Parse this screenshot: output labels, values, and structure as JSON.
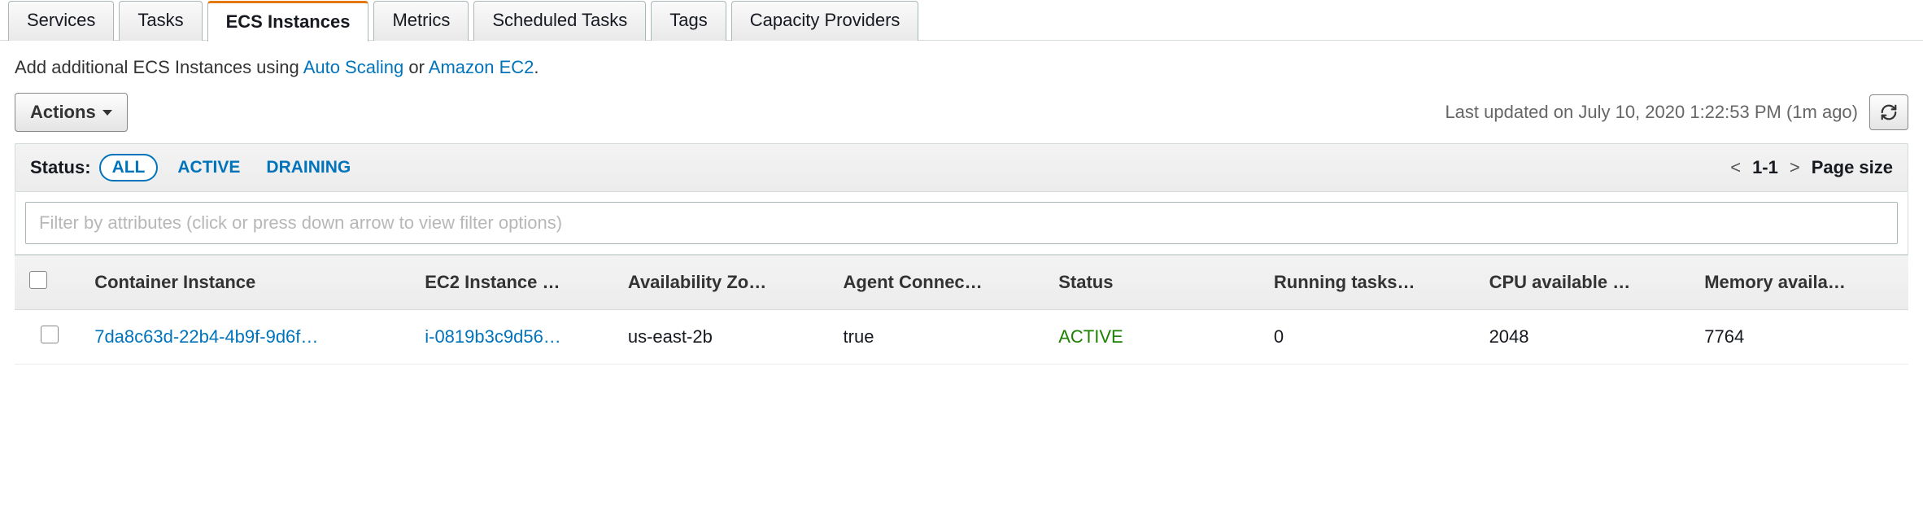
{
  "tabs": [
    {
      "label": "Services"
    },
    {
      "label": "Tasks"
    },
    {
      "label": "ECS Instances"
    },
    {
      "label": "Metrics"
    },
    {
      "label": "Scheduled Tasks"
    },
    {
      "label": "Tags"
    },
    {
      "label": "Capacity Providers"
    }
  ],
  "hint": {
    "prefix": "Add additional ECS Instances using ",
    "auto_scaling": "Auto Scaling",
    "or": " or ",
    "amazon_ec2": "Amazon EC2",
    "suffix": "."
  },
  "actions_label": "Actions",
  "last_updated": "Last updated on July 10, 2020 1:22:53 PM (1m ago)",
  "status_label": "Status:",
  "filters": {
    "all": "ALL",
    "active": "ACTIVE",
    "draining": "DRAINING"
  },
  "pager": {
    "range": "1-1",
    "page_size_label": "Page size"
  },
  "filter_placeholder": "Filter by attributes (click or press down arrow to view filter options)",
  "columns": {
    "container_instance": "Container Instance",
    "ec2_instance": "EC2 Instance …",
    "az": "Availability Zo…",
    "agent": "Agent Connec…",
    "status": "Status",
    "running": "Running tasks…",
    "cpu": "CPU available …",
    "memory": "Memory availa…"
  },
  "row": {
    "container_instance": "7da8c63d-22b4-4b9f-9d6f…",
    "ec2_instance": "i-0819b3c9d56…",
    "az": "us-east-2b",
    "agent": "true",
    "status": "ACTIVE",
    "running": "0",
    "cpu": "2048",
    "memory": "7764"
  }
}
